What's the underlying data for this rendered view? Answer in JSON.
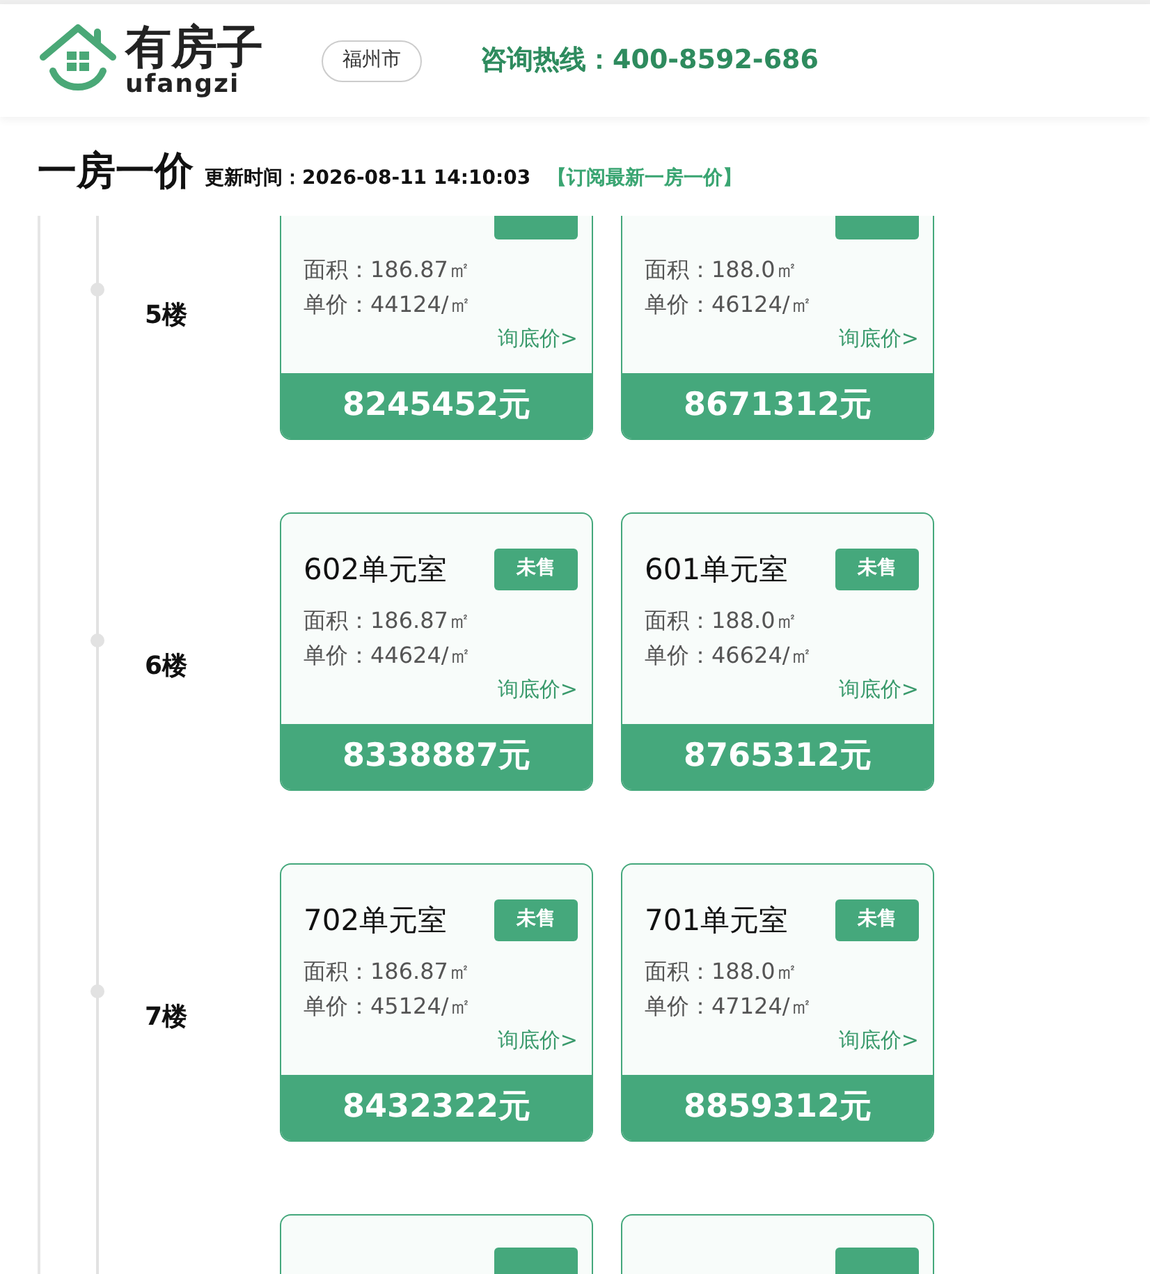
{
  "header": {
    "logo_name": "有房子",
    "logo_sub": "ufangzi",
    "city": "福州市",
    "hotline": "咨询热线：400-8592-686"
  },
  "title_bar": {
    "title": "一房一价",
    "updated": "更新时间：2026-08-11 14:10:03",
    "subscribe": "【订阅最新一房一价】"
  },
  "floors": [
    {
      "label": "5楼",
      "units": [
        {
          "area": "面积：186.87㎡",
          "unit_price": "单价：44124/㎡",
          "inquiry": "询底价>",
          "price": "8245452元"
        },
        {
          "area": "面积：188.0㎡",
          "unit_price": "单价：46124/㎡",
          "inquiry": "询底价>",
          "price": "8671312元"
        }
      ]
    },
    {
      "label": "6楼",
      "units": [
        {
          "room": "602单元室",
          "status": "未售",
          "area": "面积：186.87㎡",
          "unit_price": "单价：44624/㎡",
          "inquiry": "询底价>",
          "price": "8338887元"
        },
        {
          "room": "601单元室",
          "status": "未售",
          "area": "面积：188.0㎡",
          "unit_price": "单价：46624/㎡",
          "inquiry": "询底价>",
          "price": "8765312元"
        }
      ]
    },
    {
      "label": "7楼",
      "units": [
        {
          "room": "702单元室",
          "status": "未售",
          "area": "面积：186.87㎡",
          "unit_price": "单价：45124/㎡",
          "inquiry": "询底价>",
          "price": "8432322元"
        },
        {
          "room": "701单元室",
          "status": "未售",
          "area": "面积：188.0㎡",
          "unit_price": "单价：47124/㎡",
          "inquiry": "询底价>",
          "price": "8859312元"
        }
      ]
    },
    {
      "units": [
        {
          "cut_off": true
        },
        {
          "cut_off": true
        }
      ]
    }
  ]
}
